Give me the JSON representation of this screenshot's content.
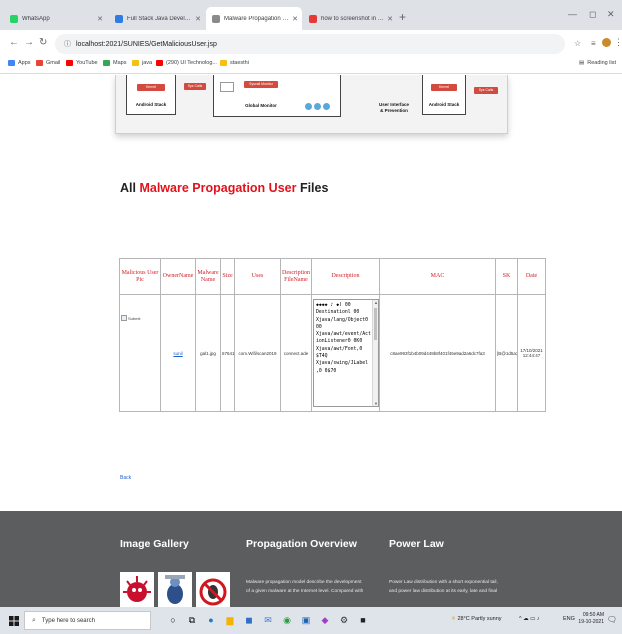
{
  "browser": {
    "tabs": [
      {
        "title": "WhatsApp",
        "color": "#25d366",
        "active": false
      },
      {
        "title": "Full Stack Java Developer | by Sr",
        "color": "#2d7be5",
        "active": false
      },
      {
        "title": "Malware Propagation in Large S",
        "color": "#8a8a8a",
        "active": true
      },
      {
        "title": "how to screenshot in laptop - Yo",
        "color": "#e53935",
        "active": false
      }
    ],
    "url": "localhost:2021/SUNIES/GetMalicious​User.jsp",
    "bookmarks": [
      {
        "label": "Apps",
        "color": "#4285f4"
      },
      {
        "label": "Gmail",
        "color": "#ea4335"
      },
      {
        "label": "YouTube",
        "color": "#ff0000"
      },
      {
        "label": "Maps",
        "color": "#34a853"
      },
      {
        "label": "java",
        "color": "#f4c20d"
      },
      {
        "label": "(290) UI Technolog...",
        "color": "#ff0000"
      },
      {
        "label": "staesthi",
        "color": "#f4c20d"
      }
    ],
    "reading_list": "Reading list"
  },
  "diagram": {
    "left_block_label": "Android Stack",
    "left_red_button": "Kernel",
    "center_red_button": "Sys Calls",
    "middle_box_label": "Global Monitor",
    "middle_red_button": "Syscall Monitor",
    "gray_button": "Analytics",
    "ui_label_line1": "User Interface",
    "ui_label_line2": "& Prevention",
    "right_block_label": "Android Stack",
    "right_red_button": "Kernel",
    "far_red_button": "Sys Calls"
  },
  "page": {
    "heading_prefix": "All",
    "heading_highlight": "Malware Propagation User",
    "heading_suffix": "Files",
    "back_link": "Back"
  },
  "table": {
    "headers": [
      "Malicious User Pic",
      "OwnerName",
      "Malware Name",
      "Size",
      "Uses",
      "Description FileName",
      "Description",
      "MAC",
      "SK",
      "Date"
    ],
    "rows": [
      {
        "pic_alt": "Submit",
        "owner": "sunil",
        "malware_name": "gal1.jpg",
        "size": "67641",
        "uses": "com.Wifi/scan2019",
        "desc_filename": "connect.ade",
        "description": "◆◆◆◆ ♪ ◆ǀ 00\nDestinationl 00\nΧjava/lang/Object0\n00\nΧjava/awt/event/Act\nionListener0 0K0\nΧjava/awt/Font,0\n$T4Q\nΧjava/swing/JLabel\n,0 0$70",
        "mac": "c8ae993f1b4b09d449b8f401f46e9ad2a6dc7fa3",
        "sk": "[B@1d5a3f4a",
        "date": "17/10/2021 12:44:47"
      }
    ]
  },
  "footer": {
    "gallery_title": "Image Gallery",
    "overview_title": "Propagation Overview",
    "overview_text_1": "Malware propagation model describe the development",
    "overview_text_2": "of a given malware at the Internet level. Compared with",
    "powerlaw_title": "Power Law",
    "powerlaw_text_1": "Power Law distribution with a short exponential tail,",
    "powerlaw_text_2": "and power law distribution at its early, late and final"
  },
  "taskbar": {
    "search_placeholder": "Type here to search",
    "weather": "28°C  Partly sunny",
    "language": "ENG",
    "time": "09:50 AM",
    "date": "19-10-2021"
  }
}
